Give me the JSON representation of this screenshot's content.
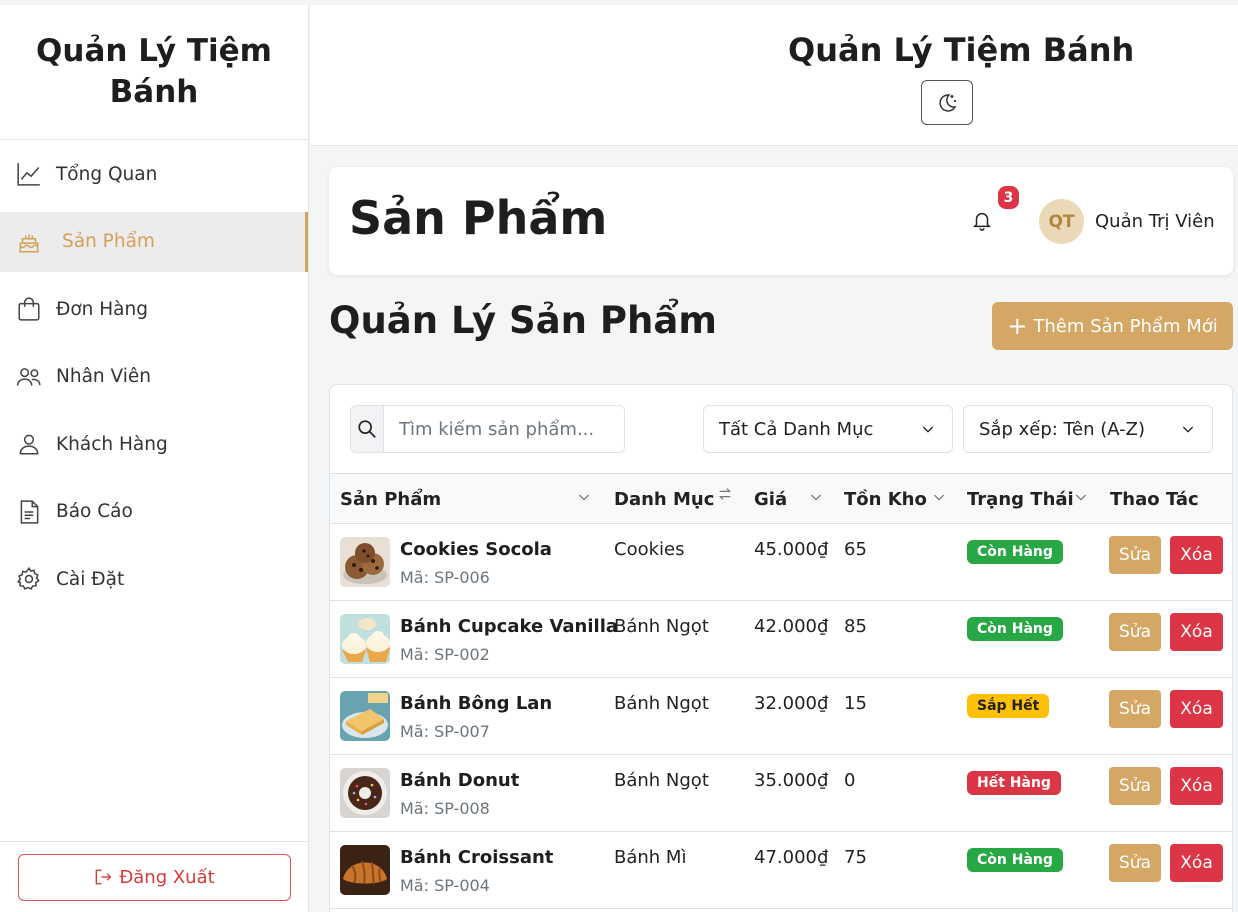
{
  "sidebar": {
    "brand": "Quản Lý Tiệm Bánh",
    "items": [
      {
        "label": "Tổng Quan",
        "icon": "chart-line-icon"
      },
      {
        "label": "Sản Phẩm",
        "icon": "cake-icon"
      },
      {
        "label": "Đơn Hàng",
        "icon": "shopping-bag-icon"
      },
      {
        "label": "Nhân Viên",
        "icon": "people-icon"
      },
      {
        "label": "Khách Hàng",
        "icon": "person-icon"
      },
      {
        "label": "Báo Cáo",
        "icon": "file-text-icon"
      },
      {
        "label": "Cài Đặt",
        "icon": "gear-icon"
      }
    ],
    "logout_label": "Đăng Xuất"
  },
  "header": {
    "title": "Quản Lý Tiệm Bánh",
    "theme_toggle_icon": "moon-stars-icon"
  },
  "page": {
    "title": "Sản Phẩm",
    "notification_count": "3",
    "user_initials": "QT",
    "user_name": "Quản Trị Viên"
  },
  "products": {
    "section_title": "Quản Lý Sản Phẩm",
    "add_button": "Thêm Sản Phẩm Mới",
    "search_placeholder": "Tìm kiếm sản phẩm...",
    "category_filter": "Tất Cả Danh Mục",
    "sort_select": "Sắp xếp: Tên (A-Z)",
    "columns": [
      "Sản Phẩm",
      "Danh Mục",
      "Giá",
      "Tồn Kho",
      "Trạng Thái",
      "Thao Tác"
    ],
    "edit_label": "Sửa",
    "delete_label": "Xóa",
    "rows": [
      {
        "name": "Cookies Socola",
        "code": "Mã: SP-006",
        "category": "Cookies",
        "price": "45.000₫",
        "stock": "65",
        "status": "Còn Hàng",
        "status_color": "#28a745"
      },
      {
        "name": "Bánh Cupcake Vanilla",
        "code": "Mã: SP-002",
        "category": "Bánh Ngọt",
        "price": "42.000₫",
        "stock": "85",
        "status": "Còn Hàng",
        "status_color": "#28a745"
      },
      {
        "name": "Bánh Bông Lan",
        "code": "Mã: SP-007",
        "category": "Bánh Ngọt",
        "price": "32.000₫",
        "stock": "15",
        "status": "Sắp Hết",
        "status_color": "#ffc107"
      },
      {
        "name": "Bánh Donut",
        "code": "Mã: SP-008",
        "category": "Bánh Ngọt",
        "price": "35.000₫",
        "stock": "0",
        "status": "Hết Hàng",
        "status_color": "#dc3545"
      },
      {
        "name": "Bánh Croissant",
        "code": "Mã: SP-004",
        "category": "Bánh Mì",
        "price": "47.000₫",
        "stock": "75",
        "status": "Còn Hàng",
        "status_color": "#28a745"
      }
    ]
  },
  "colors": {
    "accent": "#d4a764",
    "danger": "#dc3545",
    "success": "#28a745",
    "warning": "#ffc107"
  }
}
